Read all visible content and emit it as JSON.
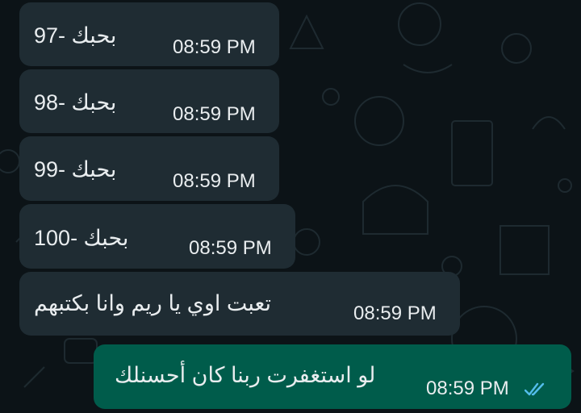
{
  "chat": {
    "messages": [
      {
        "direction": "incoming",
        "text": "بحبك -97",
        "time": "08:59 PM"
      },
      {
        "direction": "incoming",
        "text": "بحبك -98",
        "time": "08:59 PM"
      },
      {
        "direction": "incoming",
        "text": "بحبك -99",
        "time": "08:59 PM"
      },
      {
        "direction": "incoming",
        "text": "بحبك -100",
        "time": "08:59 PM"
      },
      {
        "direction": "incoming",
        "text": "تعبت اوي يا ريم وانا بكتبهم",
        "time": "08:59 PM"
      },
      {
        "direction": "outgoing",
        "text": "لو استغفرت ربنا كان أحسنلك",
        "time": "08:59 PM",
        "status_icon": "double-check-read-icon"
      }
    ]
  },
  "colors": {
    "background": "#0c1317",
    "incoming_bubble": "#1f2c33",
    "outgoing_bubble": "#005c4b",
    "text": "#e9edef",
    "read_tick": "#53bdeb"
  }
}
